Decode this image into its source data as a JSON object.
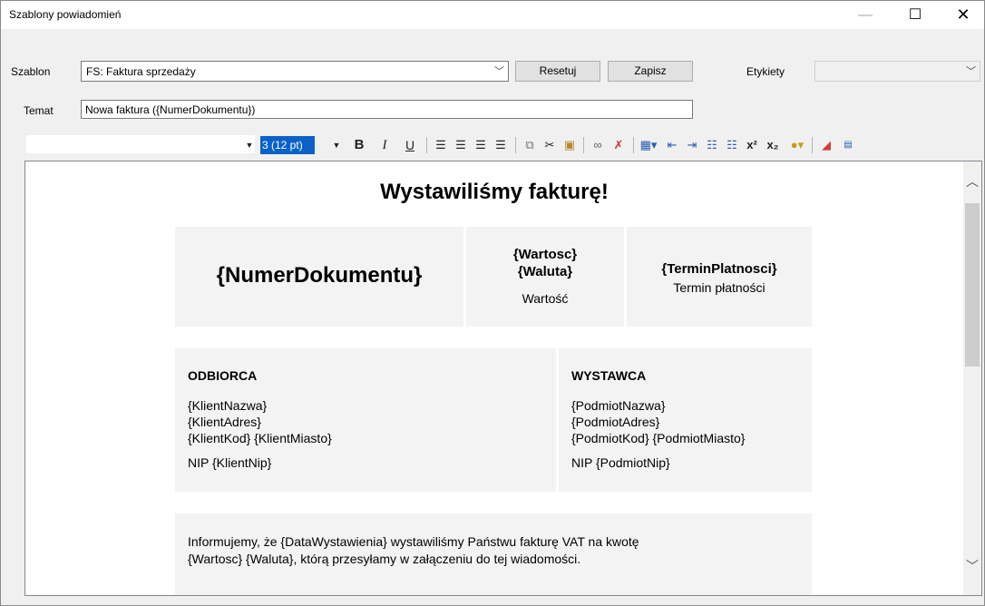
{
  "window": {
    "title": "Szablony powiadomień",
    "minimize": "—",
    "maximize": "☐",
    "close": "✕"
  },
  "form": {
    "template_label": "Szablon",
    "template_value": "FS: Faktura sprzedaży",
    "reset_label": "Resetuj",
    "save_label": "Zapisz",
    "labels_label": "Etykiety",
    "labels_value": "",
    "subject_label": "Temat",
    "subject_value": "Nowa faktura ({NumerDokumentu})"
  },
  "toolbar": {
    "font_value": "",
    "size_value": "3 (12 pt)",
    "bold": "B",
    "italic": "I",
    "underline": "U",
    "icons": [
      "align-left-icon",
      "align-center-icon",
      "align-right-icon",
      "justify-icon",
      "copy-icon",
      "cut-icon",
      "paste-icon",
      "link-icon",
      "unlink-icon",
      "table-icon",
      "outdent-icon",
      "indent-icon",
      "bullet-list-icon",
      "numbered-list-icon",
      "superscript-icon",
      "subscript-icon",
      "color-icon",
      "eraser-icon",
      "html-icon"
    ]
  },
  "document": {
    "heading": "Wystawiliśmy fakturę!",
    "numer": "{NumerDokumentu}",
    "wartosc_line1": "{Wartosc}",
    "wartosc_line2": "{Waluta}",
    "wartosc_label": "Wartość",
    "termin_value": "{TerminPlatnosci}",
    "termin_label": "Termin płatności",
    "odbiorca": {
      "title": "ODBIORCA",
      "line1": "{KlientNazwa}",
      "line2": "{KlientAdres}",
      "line3": "{KlientKod} {KlientMiasto}",
      "nip": "NIP {KlientNip}"
    },
    "wystawca": {
      "title": "WYSTAWCA",
      "line1": "{PodmiotNazwa}",
      "line2": "{PodmiotAdres}",
      "line3": "{PodmiotKod} {PodmiotMiasto}",
      "nip": "NIP {PodmiotNip}"
    },
    "info_line1": "Informujemy, że {DataWystawienia} wystawiliśmy Państwu fakturę VAT na kwotę",
    "info_line2": "{Wartosc} {Waluta}, którą przesyłamy w załączeniu do tej wiadomości."
  }
}
